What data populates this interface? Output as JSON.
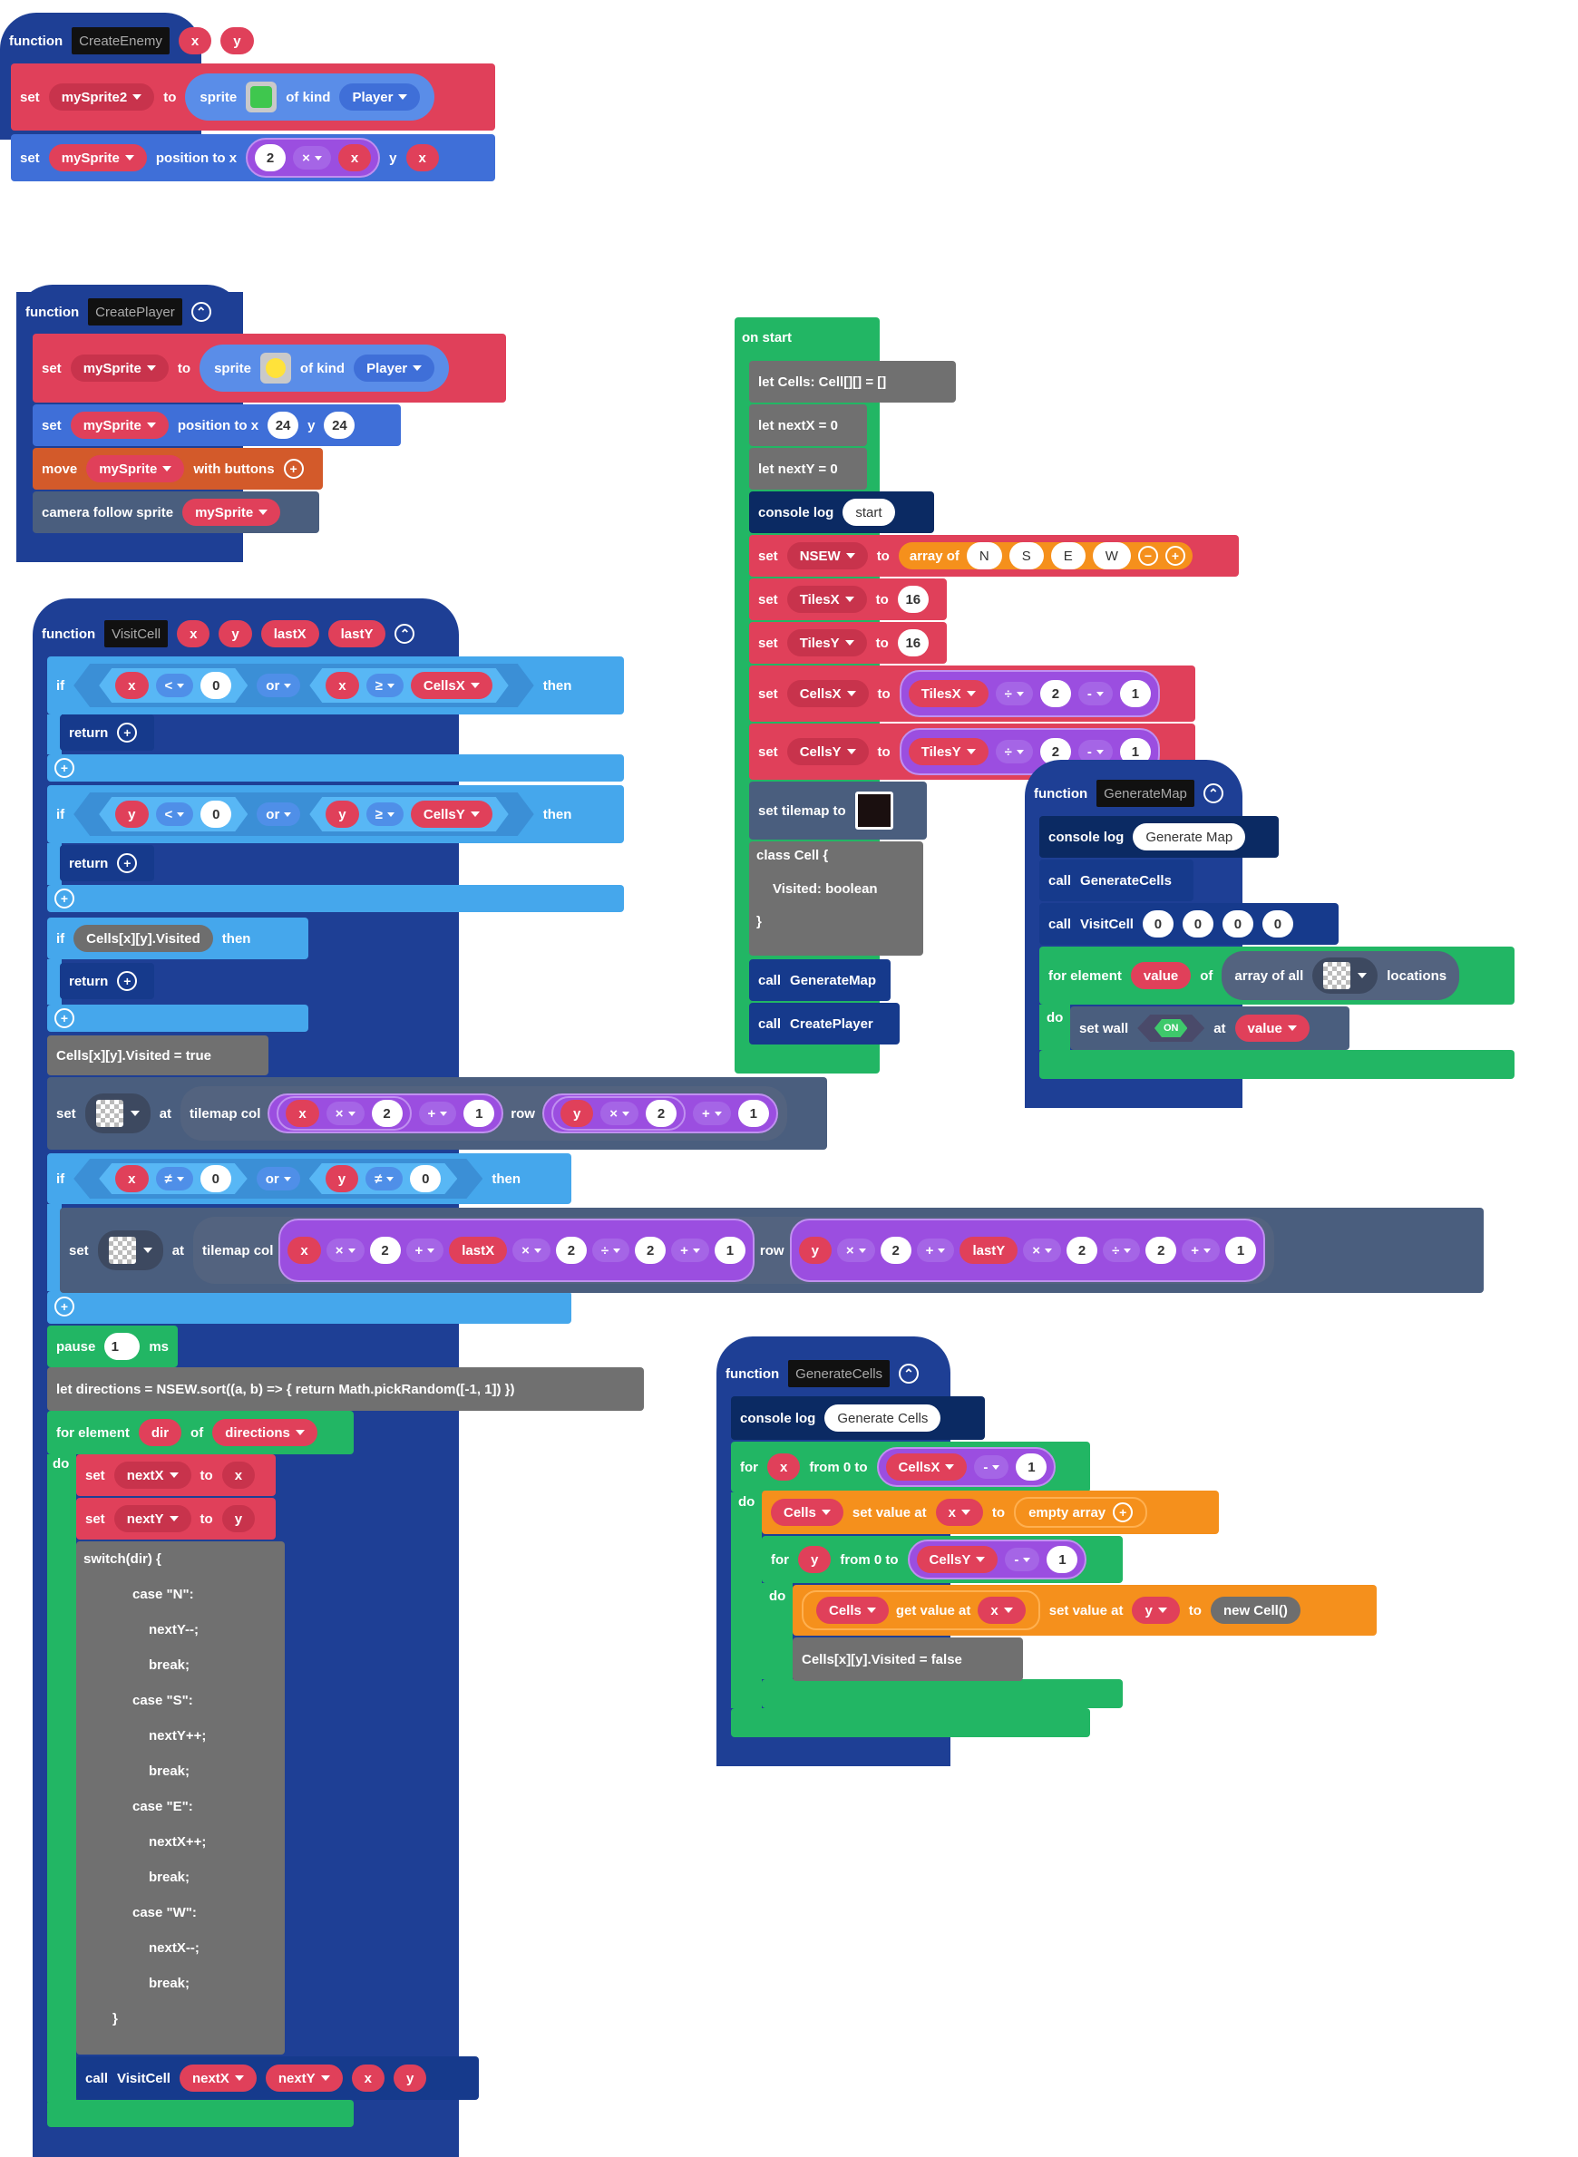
{
  "colors": {
    "function": "#1e3f95",
    "sprites": "#e0405a",
    "loops": "#22b664",
    "logic": "#45a7ec",
    "math": "#9b4ee0",
    "arrays": "#f5901c",
    "code": "#707070",
    "console": "#0b2a63",
    "controller": "#d35a2a",
    "scene": "#4a5e7e"
  },
  "kw": {
    "function": "function",
    "set": "set",
    "to": "to",
    "call": "call",
    "if": "if",
    "then": "then",
    "or": "or",
    "return": "return",
    "do": "do",
    "for": "for",
    "for_element": "for element",
    "of": "of",
    "at": "at",
    "row": "row",
    "tilemap_col": "tilemap col",
    "from0to": "from 0 to",
    "y": "y",
    "of_kind": "of kind",
    "sprite": "sprite",
    "position_to_x": "position to x",
    "console_log": "console log",
    "pause": "pause",
    "ms": "ms"
  },
  "icons": {
    "collapse": "⌃",
    "plus": "+",
    "minus": "−"
  },
  "createEnemy": {
    "name": "CreateEnemy",
    "p1": "x",
    "p2": "y",
    "var1": "mySprite2",
    "kind": "Player",
    "var2": "mySprite",
    "n2": "2",
    "times": "×",
    "px": "x",
    "py": "x"
  },
  "createPlayer": {
    "name": "CreatePlayer",
    "var": "mySprite",
    "kind": "Player",
    "x": "24",
    "y": "24",
    "move": "move",
    "with_buttons": "with buttons",
    "camera": "camera follow sprite"
  },
  "visitCell": {
    "name": "VisitCell",
    "params": [
      "x",
      "y",
      "lastX",
      "lastY"
    ],
    "lt": "<",
    "ge": "≥",
    "ne": "≠",
    "zero": "0",
    "cellsX": "CellsX",
    "cellsY": "CellsY",
    "visitedCheck": "Cells[x][y].Visited",
    "visitedTrue": "Cells[x][y].Visited = true",
    "plus": "+",
    "div": "÷",
    "one": "1",
    "two": "2",
    "lastX": "lastX",
    "lastY": "lastY",
    "pause": "1",
    "directions": "let directions = NSEW.sort((a, b) => { return Math.pickRandom([-1, 1]) })",
    "dirVar": "dir",
    "dirList": "directions",
    "nextX": "nextX",
    "nextY": "nextY",
    "switch": [
      "switch(dir) {",
      "case \"N\":",
      "nextY--;",
      "break;",
      "case \"S\":",
      "nextY++;",
      "break;",
      "case \"E\":",
      "nextX++;",
      "break;",
      "case \"W\":",
      "nextX--;",
      "break;",
      "}"
    ]
  },
  "onStart": {
    "title": "on start",
    "lines": [
      "let Cells: Cell[][] = []",
      "let nextX = 0",
      "let nextY = 0"
    ],
    "log": "start",
    "nsew": "NSEW",
    "arrayOf": "array of",
    "dirs": [
      "N",
      "S",
      "E",
      "W"
    ],
    "tilesX": "TilesX",
    "tilesY": "TilesY",
    "sixteen": "16",
    "cellsX": "CellsX",
    "cellsY": "CellsY",
    "div": "÷",
    "minus": "-",
    "two": "2",
    "one": "1",
    "tilemap": "set tilemap to",
    "cls": [
      "class Cell {",
      "Visited: boolean",
      "}"
    ],
    "call1": "GenerateMap",
    "call2": "CreatePlayer"
  },
  "generateMap": {
    "name": "GenerateMap",
    "log": "Generate Map",
    "c1": "GenerateCells",
    "c2": "VisitCell",
    "zeros": [
      "0",
      "0",
      "0",
      "0"
    ],
    "value": "value",
    "arrayOfAll": "array of all",
    "locations": "locations",
    "setWall": "set wall",
    "on": "ON"
  },
  "generateCells": {
    "name": "GenerateCells",
    "log": "Generate Cells",
    "x": "x",
    "cellsX": "CellsX",
    "minus": "-",
    "one": "1",
    "cells": "Cells",
    "setValueAt": "set value at",
    "emptyArray": "empty array",
    "y": "y",
    "cellsY": "CellsY",
    "getValueAt": "get value at",
    "newCell": "new Cell()",
    "visitedFalse": "Cells[x][y].Visited = false"
  }
}
